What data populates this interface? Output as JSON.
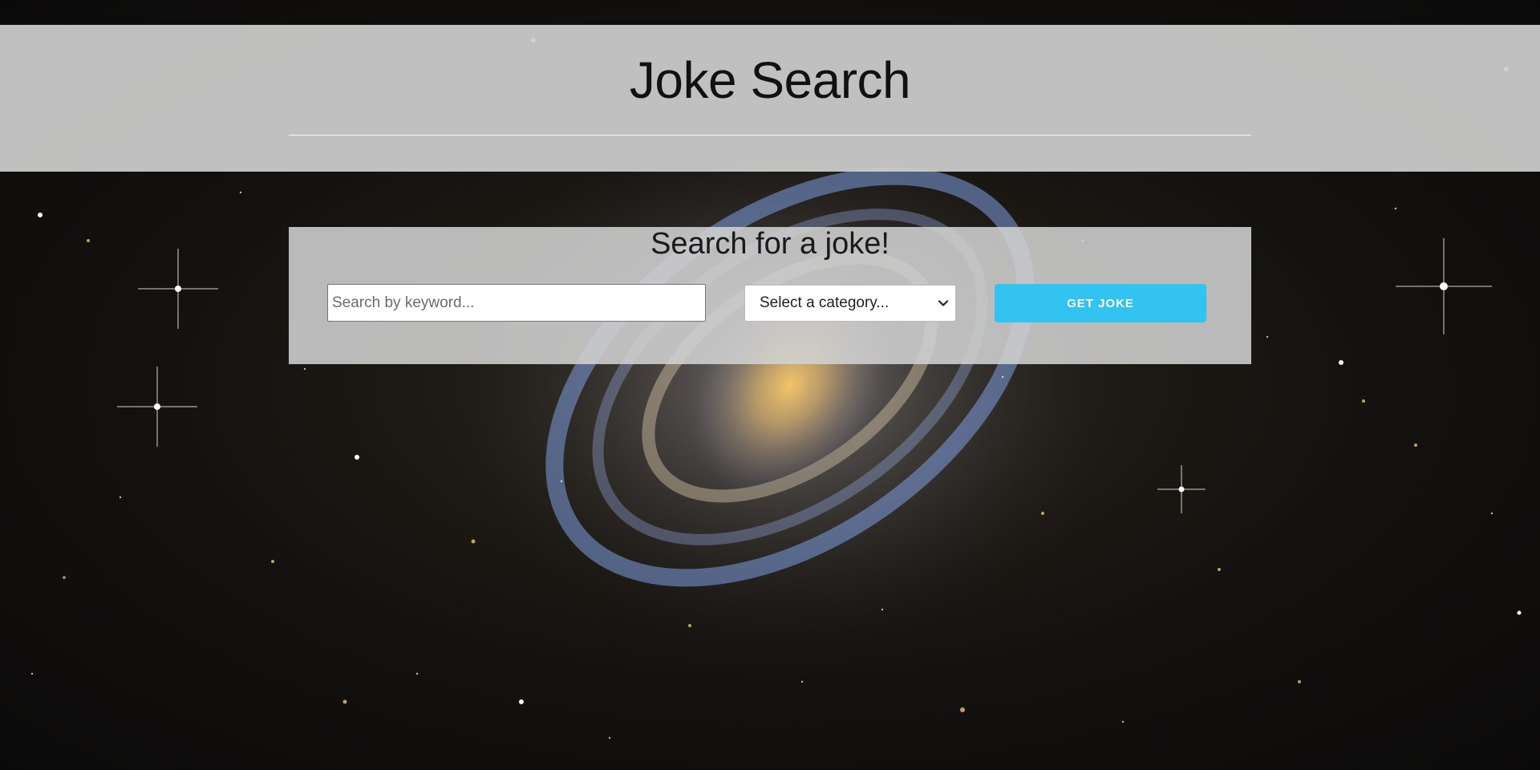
{
  "header": {
    "title": "Joke Search"
  },
  "search_panel": {
    "heading": "Search for a joke!",
    "keyword_placeholder": "Search by keyword...",
    "keyword_value": "",
    "category_selected": "Select a category...",
    "submit_label": "GET JOKE"
  },
  "theme": {
    "button_color": "#33c3f0",
    "background_description": "space-galaxy-image"
  }
}
